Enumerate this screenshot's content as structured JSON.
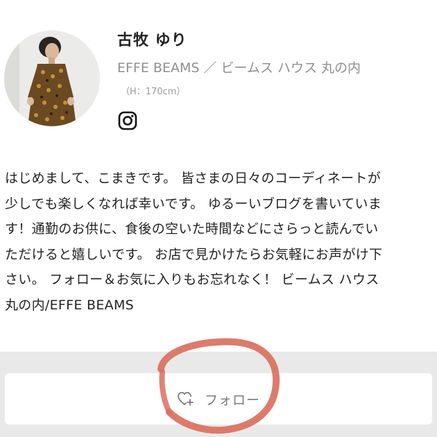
{
  "profile": {
    "name": "古牧 ゆり",
    "shop": "EFFE BEAMS ／ ビームス ハウス 丸の内",
    "height": "（H：170cm）",
    "social_icon": "instagram-icon"
  },
  "bio": {
    "lines": [
      "はじめまして、こまきです。 皆さまの日々のコーディネートが",
      "少しでも楽しくなれば幸いです。 ゆるーいブログを書いていま",
      "す！通勤のお供に、食後の空いた時間などにさらっと読んでい",
      "ただけると嬉しいです。 お店で見かけたらお気軽にお声がけ下",
      "さい。 フォロー＆お気に入りもお忘れなく！ ビームス ハウス",
      "丸の内/EFFE BEAMS"
    ]
  },
  "follow": {
    "label": "フォロー",
    "icon": "heart-plus-icon"
  },
  "colors": {
    "marker": "#d9705f",
    "follow_bg": "#e9e9e9",
    "secondary_text": "#8f8f8f"
  }
}
